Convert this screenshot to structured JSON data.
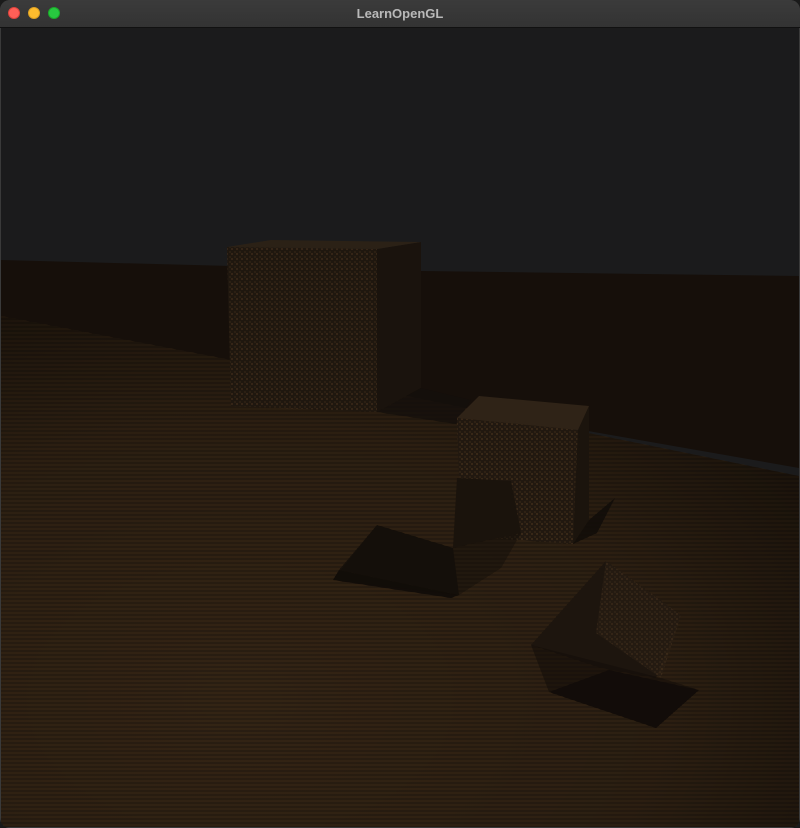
{
  "window": {
    "title": "LearnOpenGL"
  },
  "traffic_lights": [
    {
      "name": "close",
      "color": "#ff5f57"
    },
    {
      "name": "minimize",
      "color": "#febc2e"
    },
    {
      "name": "maximize",
      "color": "#28c840"
    }
  ],
  "scene": {
    "clear_color": "#1b1b1c",
    "floor_color": "#2a1e13",
    "texture_line_color": "#6b4a27",
    "shadow_color": "#140f0b"
  }
}
